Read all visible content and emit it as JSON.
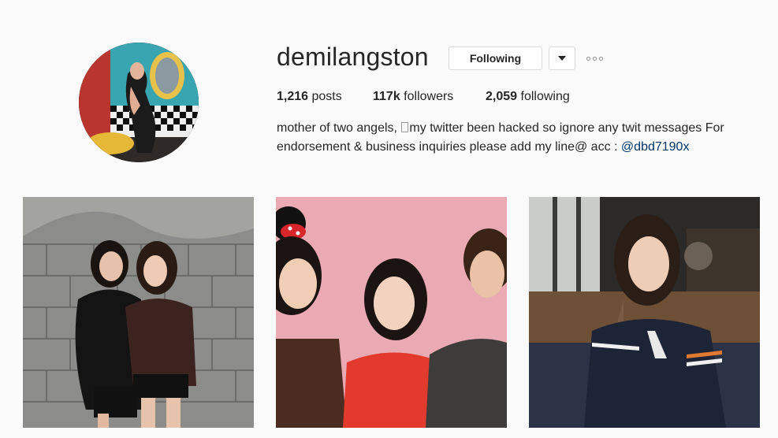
{
  "profile": {
    "username": "demilangston",
    "follow_button_label": "Following",
    "dropdown_icon": "caret-down-icon",
    "more_icon": "ellipsis-icon",
    "stats": {
      "posts_count": "1,216",
      "posts_label": "posts",
      "followers_count": "117k",
      "followers_label": "followers",
      "following_count": "2,059",
      "following_label": "following"
    },
    "bio": {
      "text_before_glyph": "mother of two angels, ",
      "text_after_glyph": "my twitter been hacked so ignore any twit messages For endorsement & business inquiries please add my line@ acc : ",
      "mention": "@dbd7190x"
    }
  },
  "posts": [
    {
      "type": "image"
    },
    {
      "type": "image"
    },
    {
      "type": "image"
    }
  ],
  "colors": {
    "background": "#fafafa",
    "text": "#262626",
    "link": "#003569",
    "border": "#dbdbdb"
  }
}
